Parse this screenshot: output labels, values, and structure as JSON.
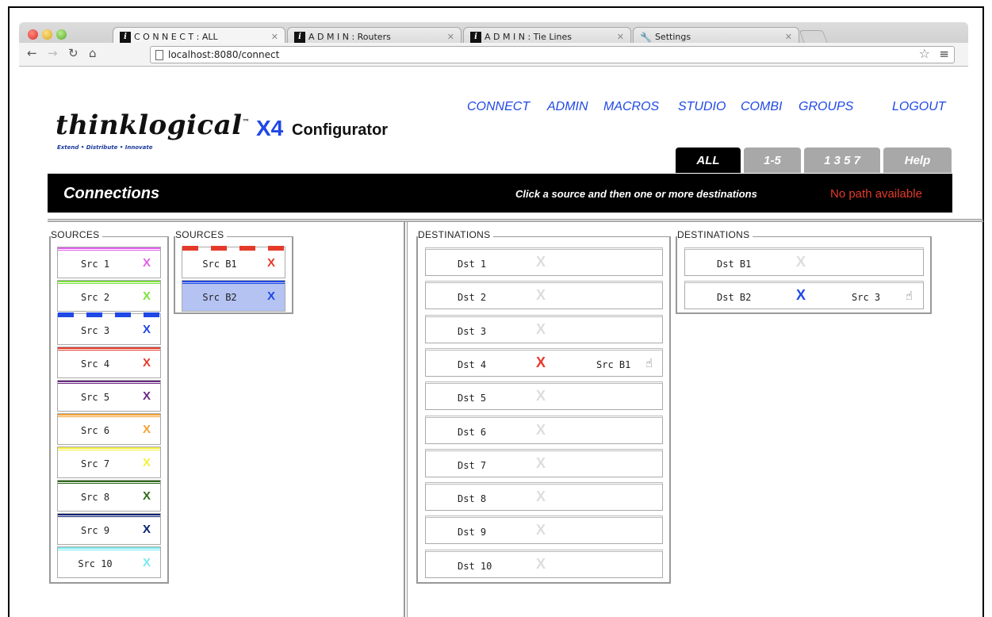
{
  "browser": {
    "tabs": [
      {
        "label": "C O N N E C T : ALL",
        "active": true
      },
      {
        "label": "A D M I N : Routers",
        "active": false
      },
      {
        "label": "A D M I N : Tie Lines",
        "active": false
      },
      {
        "label": "Settings",
        "active": false
      }
    ],
    "url": "localhost:8080/connect"
  },
  "brand": {
    "logo": "thinklogical",
    "tm": "™",
    "tagline": "Extend • Distribute • Innovate",
    "product": "X4",
    "product_suffix": "Configurator",
    "accent": "#1f48e6"
  },
  "topnav": [
    "CONNECT",
    "ADMIN",
    "MACROS",
    "STUDIO",
    "COMBI",
    "GROUPS",
    "LOGOUT"
  ],
  "subtabs": [
    {
      "label": "ALL",
      "active": true
    },
    {
      "label": "1-5",
      "active": false
    },
    {
      "label": "1 3 5 7",
      "active": false
    },
    {
      "label": "Help",
      "active": false
    }
  ],
  "header_bar": {
    "title": "Connections",
    "instruction": "Click a source and then one or more destinations",
    "status": "No path available",
    "status_color": "#e53a2a"
  },
  "sources_a": {
    "legend": "SOURCES",
    "items": [
      {
        "label": "Src 1",
        "x": "X",
        "color": "#e061e8",
        "dashed": false
      },
      {
        "label": "Src 2",
        "x": "X",
        "color": "#7be23c",
        "dashed": false
      },
      {
        "label": "Src 3",
        "x": "X",
        "color": "#1f48e6",
        "dashed": true
      },
      {
        "label": "Src 4",
        "x": "X",
        "color": "#e53a2a",
        "dashed": false
      },
      {
        "label": "Src 5",
        "x": "X",
        "color": "#6b2b82",
        "dashed": false
      },
      {
        "label": "Src 6",
        "x": "X",
        "color": "#f2a236",
        "dashed": false
      },
      {
        "label": "Src 7",
        "x": "X",
        "color": "#f4f042",
        "dashed": false
      },
      {
        "label": "Src 8",
        "x": "X",
        "color": "#2f6b1a",
        "dashed": false
      },
      {
        "label": "Src 9",
        "x": "X",
        "color": "#0b2070",
        "dashed": false
      },
      {
        "label": "Src 10",
        "x": "X",
        "color": "#79eaf0",
        "dashed": false
      }
    ]
  },
  "sources_b": {
    "legend": "SOURCES",
    "items": [
      {
        "label": "Src B1",
        "x": "X",
        "color": "#e53a2a",
        "dashed": true,
        "selected": false
      },
      {
        "label": "Src B2",
        "x": "X",
        "color": "#1f48e6",
        "dashed": false,
        "selected": true
      }
    ]
  },
  "destinations_a": {
    "legend": "DESTINATIONS",
    "items": [
      {
        "label": "Dst 1",
        "x": "X",
        "state": "off",
        "source": "",
        "hand": ""
      },
      {
        "label": "Dst 2",
        "x": "X",
        "state": "off",
        "source": "",
        "hand": ""
      },
      {
        "label": "Dst 3",
        "x": "X",
        "state": "off",
        "source": "",
        "hand": ""
      },
      {
        "label": "Dst 4",
        "x": "X",
        "state": "red",
        "source": "Src B1",
        "hand": "☝"
      },
      {
        "label": "Dst 5",
        "x": "X",
        "state": "off",
        "source": "",
        "hand": ""
      },
      {
        "label": "Dst 6",
        "x": "X",
        "state": "off",
        "source": "",
        "hand": ""
      },
      {
        "label": "Dst 7",
        "x": "X",
        "state": "off",
        "source": "",
        "hand": ""
      },
      {
        "label": "Dst 8",
        "x": "X",
        "state": "off",
        "source": "",
        "hand": ""
      },
      {
        "label": "Dst 9",
        "x": "X",
        "state": "off",
        "source": "",
        "hand": ""
      },
      {
        "label": "Dst 10",
        "x": "X",
        "state": "off",
        "source": "",
        "hand": ""
      }
    ]
  },
  "destinations_b": {
    "legend": "DESTINATIONS",
    "items": [
      {
        "label": "Dst B1",
        "x": "X",
        "state": "off",
        "source": "",
        "hand": ""
      },
      {
        "label": "Dst B2",
        "x": "X",
        "state": "blue",
        "source": "Src 3",
        "hand": "☝"
      }
    ]
  }
}
